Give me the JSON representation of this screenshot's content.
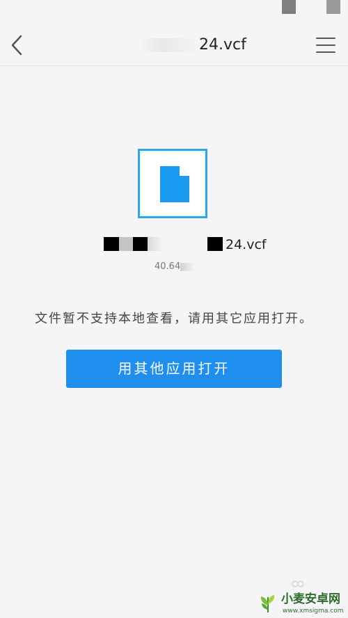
{
  "nav": {
    "title_visible": "24.vcf"
  },
  "file": {
    "name_visible": "24.vcf",
    "size_visible": "40.64"
  },
  "message": "文件暂不支持本地查看，请用其它应用打开。",
  "actions": {
    "open_with_other_app": "用其他应用打开"
  },
  "watermark": {
    "name": "小麦安卓网",
    "url": "www.xmsigma.com"
  },
  "colors": {
    "accent": "#1f8fef",
    "icon_border": "#2aa6ee",
    "background": "#f5f5f7"
  },
  "icons": {
    "back": "chevron-left-icon",
    "menu": "hamburger-menu-icon",
    "file": "document-icon"
  }
}
